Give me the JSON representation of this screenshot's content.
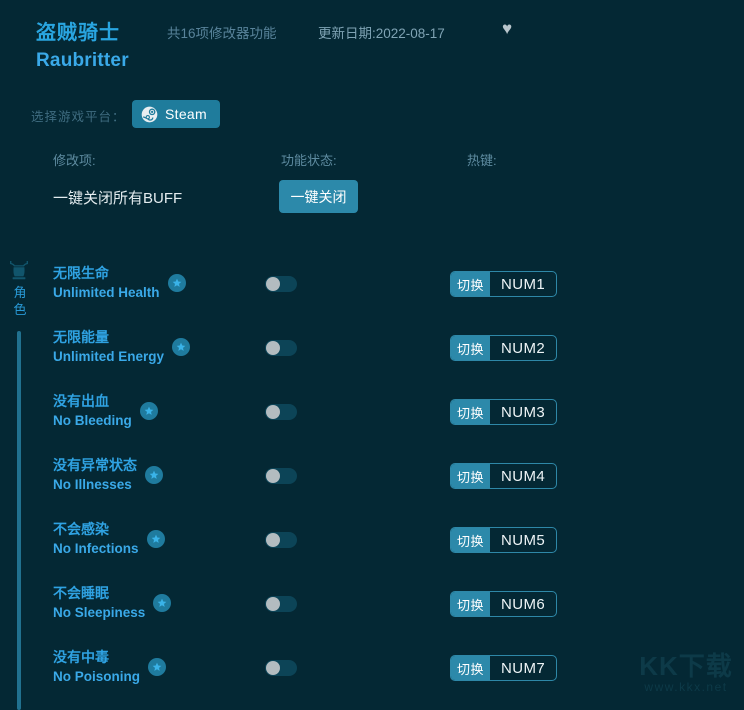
{
  "header": {
    "title_cn": "盗贼骑士",
    "title_en": "Raubritter",
    "trainer_count": "共16项修改器功能",
    "update_date": "更新日期:2022-08-17",
    "favorite_icon": "♥"
  },
  "platform": {
    "label": "选择游戏平台：",
    "selected": "Steam"
  },
  "columns": {
    "modify": "修改项:",
    "status": "功能状态:",
    "hotkey": "热键:"
  },
  "global_action": {
    "label": "一键关闭所有BUFF",
    "button": "一键关闭"
  },
  "category": {
    "name": "角色",
    "icon": "helmet-icon"
  },
  "rows": [
    {
      "cn": "无限生命",
      "en": "Unlimited Health",
      "toggle_state": "off",
      "action": "切换",
      "key": "NUM1",
      "star": true
    },
    {
      "cn": "无限能量",
      "en": "Unlimited Energy",
      "toggle_state": "off",
      "action": "切换",
      "key": "NUM2",
      "star": true
    },
    {
      "cn": "没有出血",
      "en": "No Bleeding",
      "toggle_state": "off",
      "action": "切换",
      "key": "NUM3",
      "star": true
    },
    {
      "cn": "没有异常状态",
      "en": "No Illnesses",
      "toggle_state": "off",
      "action": "切换",
      "key": "NUM4",
      "star": true
    },
    {
      "cn": "不会感染",
      "en": "No Infections",
      "toggle_state": "off",
      "action": "切换",
      "key": "NUM5",
      "star": true
    },
    {
      "cn": "不会睡眠",
      "en": "No Sleepiness",
      "toggle_state": "off",
      "action": "切换",
      "key": "NUM6",
      "star": true
    },
    {
      "cn": "没有中毒",
      "en": "No Poisoning",
      "toggle_state": "off",
      "action": "切换",
      "key": "NUM7",
      "star": true
    }
  ],
  "watermark": {
    "main": "KK下载",
    "sub": "www.kkx.net"
  },
  "colors": {
    "background": "#042834",
    "accent_teal": "#2c89aa",
    "title_blue": "#2fa2e2",
    "muted_label": "#5e8ba0",
    "rail_bar": "#21718f"
  }
}
